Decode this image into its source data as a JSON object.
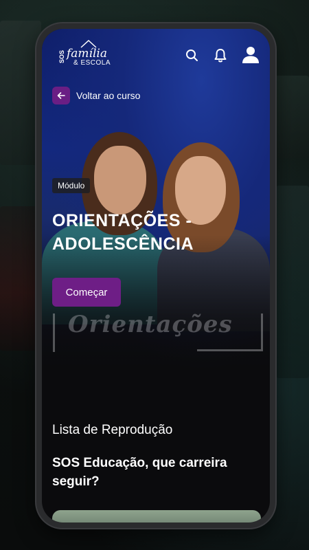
{
  "colors": {
    "accent": "#6e1e86",
    "background": "#0b0b0d",
    "hero_blue": "#13287e"
  },
  "header": {
    "logo": {
      "sos": "SOS",
      "main": "família",
      "sub": "& ESCOLA"
    },
    "icons": [
      "search-icon",
      "bell-icon",
      "user-icon"
    ]
  },
  "back": {
    "label": "Voltar ao curso",
    "icon": "arrow-left-icon"
  },
  "module": {
    "chip": "Módulo",
    "title": "ORIENTAÇÕES - ADOLESCÊNCIA",
    "cta": "Começar",
    "watermark": "Orientações"
  },
  "playlist": {
    "heading": "Lista de Reprodução",
    "items": [
      {
        "title": "SOS Educação, que carreira seguir?"
      }
    ]
  }
}
